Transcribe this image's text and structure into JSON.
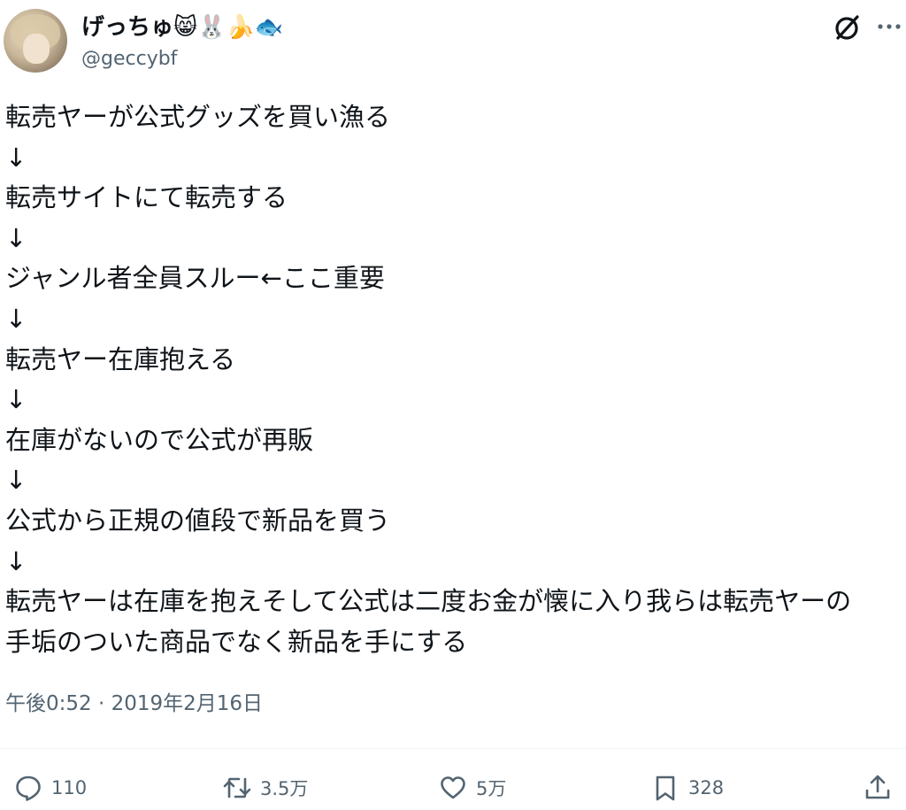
{
  "author": {
    "display_name": "げっちゅ😸🐰🍌🐟",
    "handle": "@geccybf",
    "avatar_icon": "avatar-image"
  },
  "header_icons": [
    "grok-icon",
    "more-icon"
  ],
  "tweet": {
    "lines": [
      "転売ヤーが公式グッズを買い漁る",
      "↓",
      "転売サイトにて転売する",
      "↓",
      "ジャンル者全員スルー←ここ重要",
      "↓",
      "転売ヤー在庫抱える",
      "↓",
      "在庫がないので公式が再販",
      "↓",
      "公式から正規の値段で新品を買う",
      "↓",
      "転売ヤーは在庫を抱えそして公式は二度お金が懐に入り我らは転売ヤーの",
      "手垢のついた商品でなく新品を手にする"
    ],
    "timestamp": "午後0:52 · 2019年2月16日"
  },
  "actions": {
    "reply_count": "110",
    "retweet_count": "3.5万",
    "like_count": "5万",
    "bookmark_count": "328"
  },
  "colors": {
    "text": "#0f1419",
    "secondary": "#536471",
    "divider": "#eff3f4"
  }
}
